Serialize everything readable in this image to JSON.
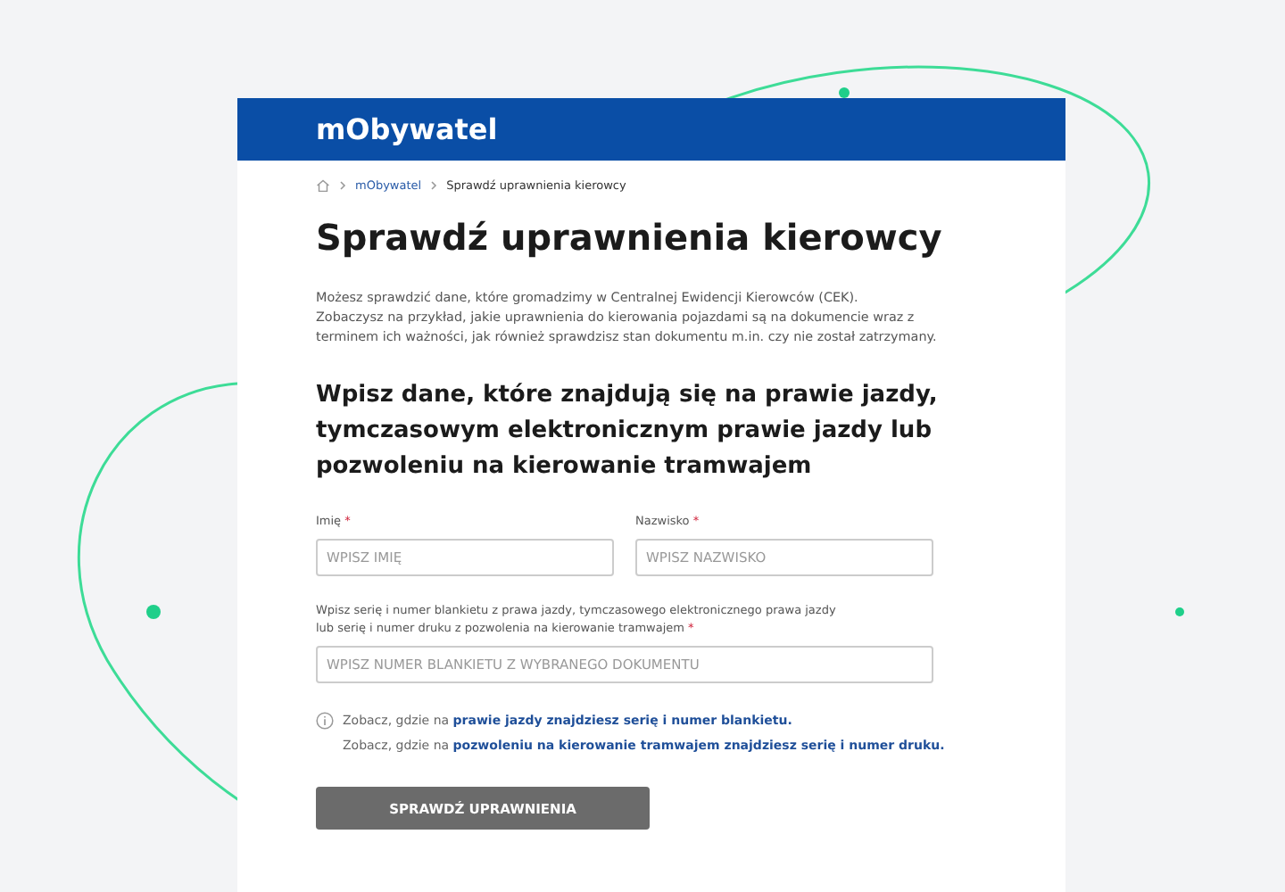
{
  "header": {
    "logo": "mObywatel"
  },
  "breadcrumbs": [
    {
      "label": "mObywatel",
      "kind": "link"
    },
    {
      "label": "Sprawdź uprawnienia kierowcy",
      "kind": "current"
    }
  ],
  "title": "Sprawdź uprawnienia kierowcy",
  "intro": "Możesz sprawdzić dane, które gromadzimy w Centralnej Ewidencji Kierowców (CEK).\nZobaczysz na przykład, jakie uprawnienia do kierowania pojazdami są na dokumencie wraz z\nterminem ich ważności, jak również sprawdzisz stan dokumentu m.in. czy nie został zatrzymany.",
  "form_heading": "Wpisz dane, które znajdują się na prawie jazdy,\ntymczasowym elektronicznym prawie jazdy lub\npozwoleniu na kierowanie tramwajem",
  "fields": [
    {
      "label": "Imię",
      "required_mark": "*",
      "placeholder": "WPISZ IMIĘ"
    },
    {
      "label": "Nazwisko",
      "required_mark": "*",
      "placeholder": "WPISZ NAZWISKO"
    },
    {
      "label": "Wpisz serię i numer blankietu z prawa jazdy, tymczasowego elektronicznego prawa jazdy\nlub serię i numer druku z pozwolenia na kierowanie tramwajem",
      "required_mark": "*",
      "placeholder": "WPISZ NUMER BLANKIETU Z WYBRANEGO DOKUMENTU"
    }
  ],
  "info": [
    {
      "text": "Zobacz, gdzie na ",
      "link": "prawie jazdy znajdziesz serię i numer blankietu."
    },
    {
      "text": "Zobacz, gdzie na ",
      "link": "pozwoleniu na kierowanie tramwajem znajdziesz serię i numer druku."
    }
  ],
  "submit": {
    "label": "SPRAWDŹ UPRAWNIENIA",
    "disabled": true
  }
}
